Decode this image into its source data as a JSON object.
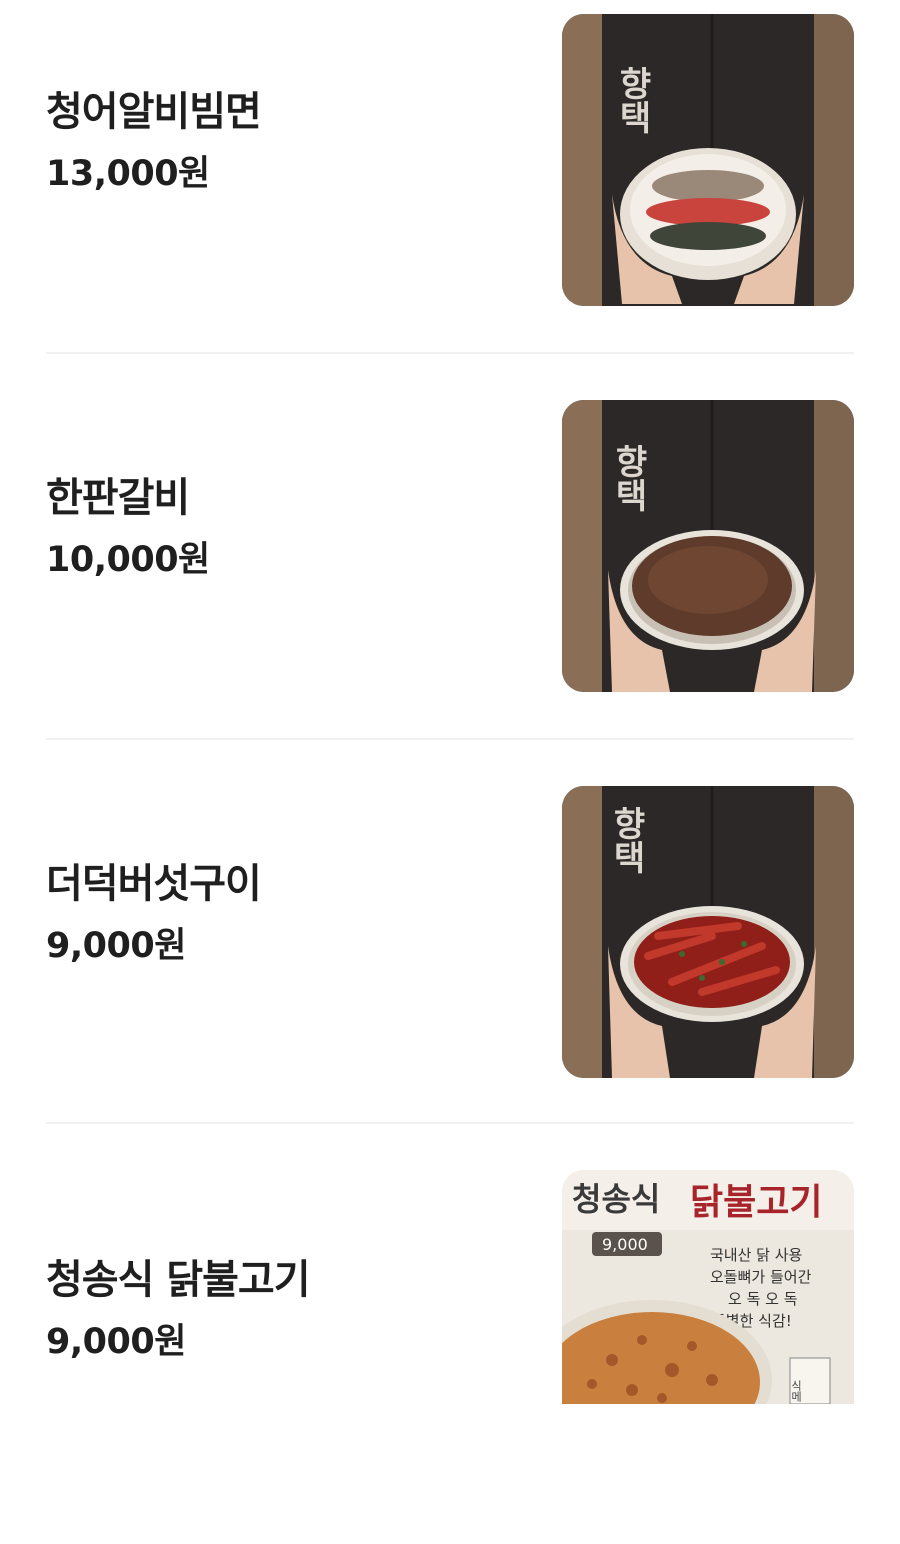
{
  "menu": {
    "items": [
      {
        "name": "청어알비빔면",
        "price": "13,000원",
        "image_icon": "bibimmyeon-bowl-photo"
      },
      {
        "name": "한판갈비",
        "price": "10,000원",
        "image_icon": "galbi-plate-photo"
      },
      {
        "name": "더덕버섯구이",
        "price": "9,000원",
        "image_icon": "deodeok-mushroom-plate-photo"
      },
      {
        "name": "청송식 닭불고기",
        "price": "9,000원",
        "image_icon": "dak-bulgogi-poster-photo"
      }
    ],
    "apron_text": "향택",
    "poster": {
      "title_left": "청송식",
      "title_right": "닭불고기",
      "badge": "9,000",
      "lines": [
        "국내산 닭 사용",
        "오돌뼈가 들어간",
        "오 독 오 독",
        "특별한 식감!"
      ],
      "corner": "식메"
    }
  },
  "colors": {
    "text": "#1f1f1f",
    "divider": "#f1f1f1",
    "apron": "#2b2827",
    "wall": "#8a6e55",
    "poster_red": "#a8242b"
  }
}
